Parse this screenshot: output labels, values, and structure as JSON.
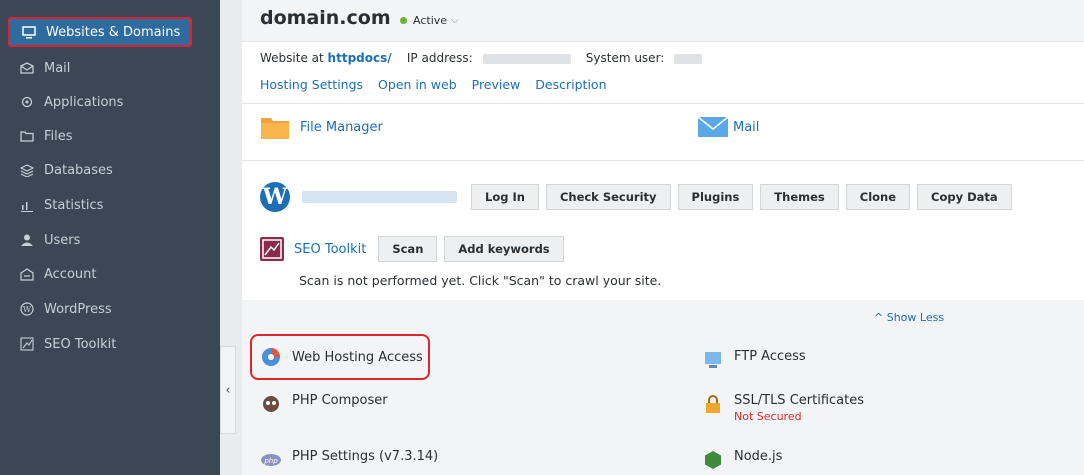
{
  "sidebar": {
    "items": [
      {
        "label": "Websites & Domains",
        "icon": "monitor-icon",
        "active": true
      },
      {
        "label": "Mail",
        "icon": "mail-icon"
      },
      {
        "label": "Applications",
        "icon": "gear-icon"
      },
      {
        "label": "Files",
        "icon": "folder-icon"
      },
      {
        "label": "Databases",
        "icon": "database-icon"
      },
      {
        "label": "Statistics",
        "icon": "bar-chart-icon"
      },
      {
        "label": "Users",
        "icon": "user-icon"
      },
      {
        "label": "Account",
        "icon": "account-icon"
      },
      {
        "label": "WordPress",
        "icon": "wordpress-icon"
      },
      {
        "label": "SEO Toolkit",
        "icon": "seo-toolkit-icon"
      }
    ],
    "collapse_glyph": "‹"
  },
  "header": {
    "domain": "domain.com",
    "status": "Active"
  },
  "info": {
    "website_at": "Website at",
    "docroot": "httpdocs/",
    "ip_label": "IP address:",
    "system_user_label": "System user:"
  },
  "links": [
    "Hosting Settings",
    "Open in web",
    "Preview",
    "Description"
  ],
  "tools": {
    "file_manager": "File Manager",
    "mail": "Mail"
  },
  "wordpress": {
    "buttons": [
      "Log In",
      "Check Security",
      "Plugins",
      "Themes",
      "Clone",
      "Copy Data"
    ]
  },
  "seo": {
    "name": "SEO Toolkit",
    "scan": "Scan",
    "add_keywords": "Add keywords",
    "message": "Scan is not performed yet. Click \"Scan\" to crawl your site."
  },
  "more": {
    "show_less": "Show Less",
    "web_hosting_access": "Web Hosting Access",
    "ftp_access": "FTP Access",
    "php_composer": "PHP Composer",
    "ssl": "SSL/TLS Certificates",
    "ssl_status": "Not Secured",
    "php_settings": "PHP Settings (v7.3.14)",
    "nodejs": "Node.js"
  },
  "colors": {
    "sidebar_bg": "#3b4754",
    "active_bg": "#2e6b9e",
    "highlight": "#e0242c",
    "link": "#1b6fb5",
    "status_green": "#67b52b",
    "warning_red": "#d52b2b"
  }
}
